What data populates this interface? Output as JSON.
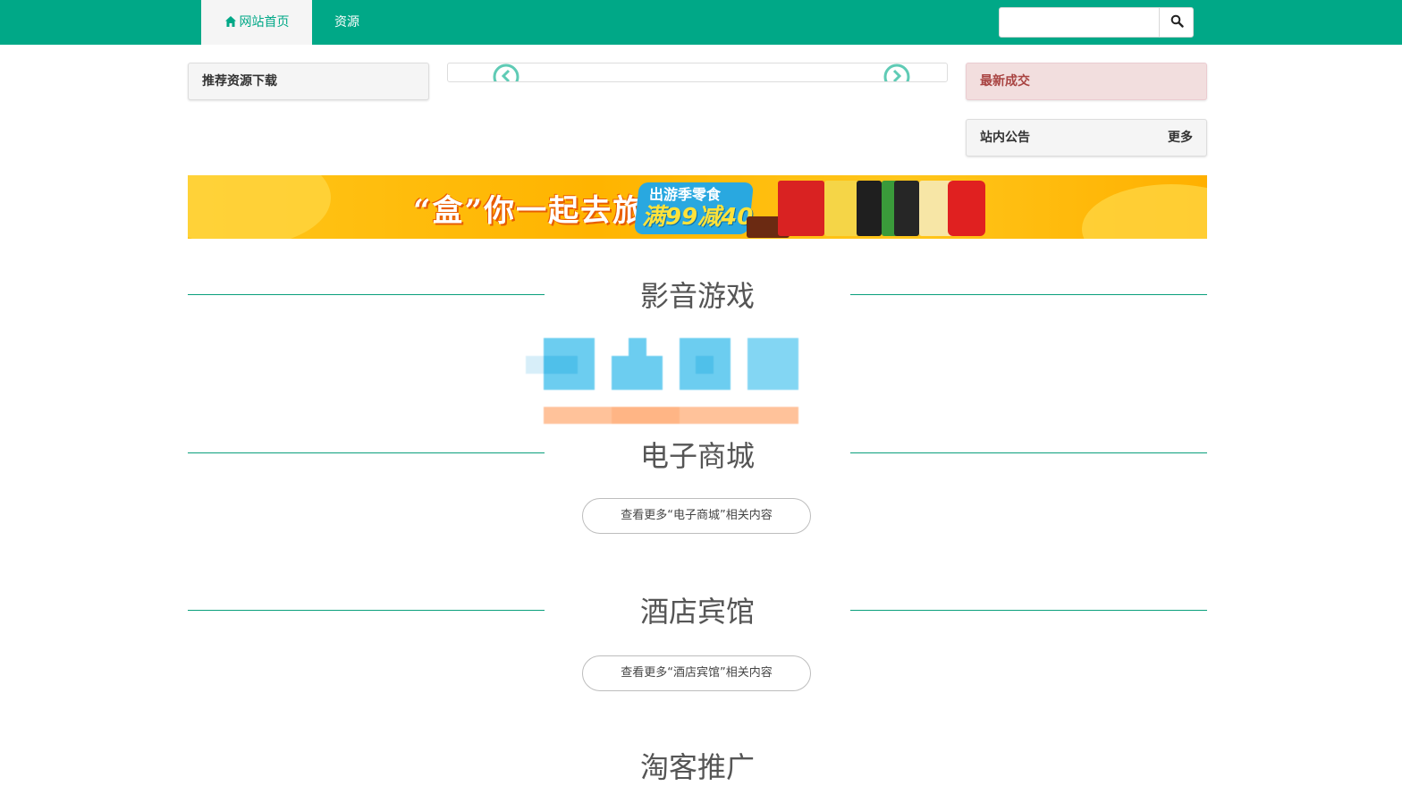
{
  "nav": {
    "home_label": "网站首页",
    "resources_label": "资源",
    "search_placeholder": ""
  },
  "panels": {
    "recommended": "推荐资源下载",
    "latest_deals": "最新成交",
    "announcements": "站内公告",
    "announcements_more": "更多"
  },
  "banner": {
    "headline": "“盒”你一起去旅行",
    "badge_line1": "出游季零食",
    "badge_line2": "满99减40"
  },
  "sections": [
    {
      "title": "影音游戏",
      "more_label": ""
    },
    {
      "title": "电子商城",
      "more_label": "查看更多“电子商城”相关内容"
    },
    {
      "title": "酒店宾馆",
      "more_label": "查看更多“酒店宾馆”相关内容"
    },
    {
      "title": "淘客推广",
      "more_label": ""
    }
  ],
  "colors": {
    "brand_green": "#00a887",
    "line_green": "#0a9f7c",
    "deal_red": "#a94442"
  },
  "icons": {
    "home": "home-icon",
    "search": "search-icon",
    "prev": "chevron-left-circle-icon",
    "next": "chevron-right-circle-icon"
  }
}
